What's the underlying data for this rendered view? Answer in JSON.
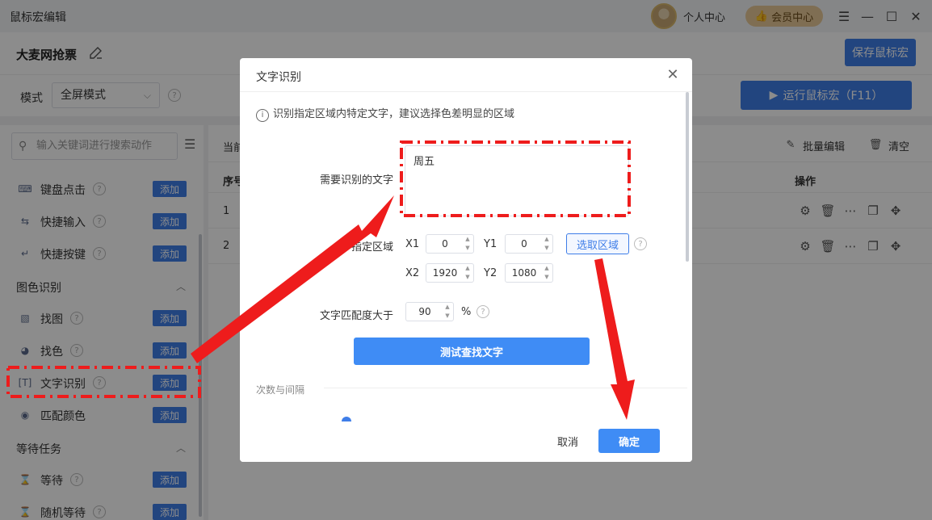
{
  "app": {
    "title": "鼠标宏编辑",
    "personal_center": "个人中心",
    "vip_center": "会员中心"
  },
  "macro": {
    "name": "大麦网抢票",
    "save_label": "保存鼠标宏",
    "mode_label": "模式",
    "mode_value": "全屏模式",
    "run_label": "运行鼠标宏（F11）"
  },
  "sidebar": {
    "search_placeholder": "输入关键词进行搜索动作",
    "add_label": "添加",
    "items": [
      {
        "label": "键盘点击",
        "icon": "keyboard-icon"
      },
      {
        "label": "快捷输入",
        "icon": "swap-icon"
      },
      {
        "label": "快捷按键",
        "icon": "enter-key-icon"
      }
    ],
    "groups": [
      {
        "title": "图色识别",
        "items": [
          {
            "label": "找图",
            "icon": "image-icon"
          },
          {
            "label": "找色",
            "icon": "palette-icon"
          },
          {
            "label": "文字识别",
            "icon": "text-recognition-icon"
          },
          {
            "label": "匹配颜色",
            "icon": "dot-circle-icon"
          }
        ]
      },
      {
        "title": "等待任务",
        "items": [
          {
            "label": "等待",
            "icon": "hourglass-icon"
          },
          {
            "label": "随机等待",
            "icon": "hourglass-icon"
          }
        ]
      }
    ]
  },
  "main": {
    "current_partial": "当前",
    "batch_edit": "批量编辑",
    "clear": "清空",
    "col_index": "序号",
    "col_actions": "操作",
    "rows": [
      "1",
      "2"
    ]
  },
  "dialog": {
    "title": "文字识别",
    "info": "识别指定区域内特定文字，建议选择色差明显的区域",
    "text_label": "需要识别的文字",
    "text_value": "周五",
    "region_label": "指定区域",
    "x1_label": "X1",
    "x1_value": "0",
    "y1_label": "Y1",
    "y1_value": "0",
    "x2_label": "X2",
    "x2_value": "1920",
    "y2_label": "Y2",
    "y2_value": "1080",
    "select_region": "选取区域",
    "match_label": "文字匹配度大于",
    "match_value": "90",
    "match_unit": "%",
    "test_button": "测试查找文字",
    "section_title": "次数与间隔",
    "cancel": "取消",
    "confirm": "确定"
  },
  "colors": {
    "accent": "#3f7ee8",
    "annotation": "#ee1c1c"
  }
}
